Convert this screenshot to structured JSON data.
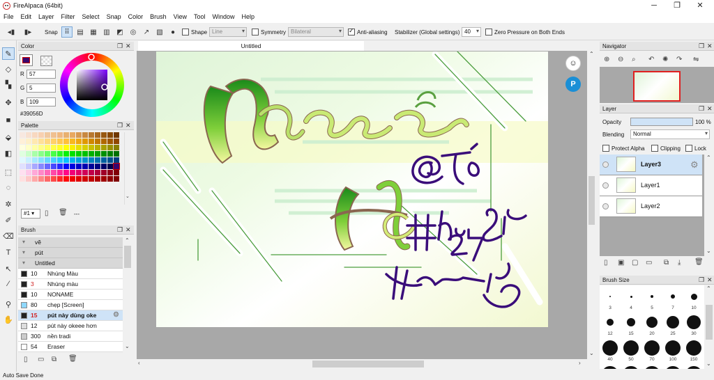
{
  "window": {
    "title": "FireAlpaca (64bit)",
    "minimize": "─",
    "maximize": "❐",
    "close": "✕"
  },
  "menu": [
    "File",
    "Edit",
    "Layer",
    "Filter",
    "Select",
    "Snap",
    "Color",
    "Brush",
    "View",
    "Tool",
    "Window",
    "Help"
  ],
  "toolbar": {
    "snap_label": "Snap",
    "shape_label": "Shape",
    "shape_value": "Line",
    "symmetry_label": "Symmetry",
    "symmetry_value": "Bilateral",
    "antialias_label": "Anti-aliasing",
    "stabilizer_label": "Stabilizer (Global settings)",
    "stabilizer_value": "40",
    "zero_pressure_label": "Zero Pressure on Both Ends"
  },
  "color_panel": {
    "title": "Color",
    "r_label": "R",
    "r": "57",
    "g_label": "G",
    "g": "5",
    "b_label": "B",
    "b": "109",
    "hex": "#39056D",
    "current_color": "#39056d"
  },
  "palette_panel": {
    "title": "Palette",
    "index": "#1",
    "separator": "---",
    "colors": [
      [
        "#f8e8e0",
        "#f8e0d0",
        "#f8d8c0",
        "#f8d0b0",
        "#f0c8a0",
        "#f0c090",
        "#f0b880",
        "#e8b070",
        "#e8a860",
        "#d89850",
        "#c88840",
        "#b87830",
        "#a86820",
        "#985810",
        "#884800",
        "#703800"
      ],
      [
        "#fff0d8",
        "#fff0c8",
        "#ffe8b0",
        "#ffe098",
        "#ffd880",
        "#ffd068",
        "#ffc850",
        "#ffc038",
        "#f8b820",
        "#f0a810",
        "#e09800",
        "#d08800",
        "#c07800",
        "#b06800",
        "#a05800",
        "#904800"
      ],
      [
        "#ffffe0",
        "#ffffc8",
        "#ffffa8",
        "#ffff88",
        "#ffff68",
        "#ffff48",
        "#ffff28",
        "#ffff08",
        "#f8f000",
        "#e8e000",
        "#d8d000",
        "#c8c000",
        "#b8b000",
        "#a8a000",
        "#989000",
        "#888000"
      ],
      [
        "#e0ffe0",
        "#c8ffc8",
        "#a8ffa8",
        "#88ff88",
        "#68ff68",
        "#48ff48",
        "#28f828",
        "#08f008",
        "#00e000",
        "#00d000",
        "#00c000",
        "#00b000",
        "#00a000",
        "#009000",
        "#008000",
        "#007000"
      ],
      [
        "#e0f8ff",
        "#c8f0ff",
        "#a8e8ff",
        "#88e0ff",
        "#68d8ff",
        "#48d0ff",
        "#28c8ff",
        "#08c0ff",
        "#00b0f0",
        "#00a0e0",
        "#0090d0",
        "#0080c0",
        "#0070b0",
        "#0060a0",
        "#005090",
        "#004080"
      ],
      [
        "#e0e0ff",
        "#c8c8ff",
        "#a8a8ff",
        "#8888ff",
        "#6868ff",
        "#4848ff",
        "#2828ff",
        "#0808f8",
        "#0000e0",
        "#0000c8",
        "#0000b0",
        "#000098",
        "#000080",
        "#000068",
        "#000050",
        "#39056d"
      ],
      [
        "#ffe0f0",
        "#ffc8e8",
        "#ffa8d8",
        "#ff88c8",
        "#ff68b8",
        "#ff48a8",
        "#ff2898",
        "#ff0888",
        "#f00078",
        "#e00068",
        "#d00058",
        "#c00048",
        "#b00038",
        "#a00028",
        "#900018",
        "#800008"
      ],
      [
        "#ffe0e0",
        "#ffc8c8",
        "#ffa8a8",
        "#ff8888",
        "#ff6868",
        "#ff4848",
        "#ff2828",
        "#ff0808",
        "#f00000",
        "#e00000",
        "#d00000",
        "#c00000",
        "#b00000",
        "#a00000",
        "#900000",
        "#800000"
      ]
    ]
  },
  "brush_panel": {
    "title": "Brush",
    "groups": [
      "vẽ",
      "pút",
      "Untitled"
    ],
    "items": [
      {
        "size": "10",
        "name": "Nhúng Màu",
        "color": "#222222"
      },
      {
        "size": "3",
        "name": "Nhúng màu",
        "color": "#222222"
      },
      {
        "size": "10",
        "name": "NONAME",
        "color": "#222222"
      },
      {
        "size": "80",
        "name": "chẹp [Screen]",
        "color": "#8fd8ff"
      },
      {
        "size": "15",
        "name": "pút này dùng oke",
        "color": "#222222"
      },
      {
        "size": "12",
        "name": "pút này okeee hơn",
        "color": "#dddddd"
      },
      {
        "size": "300",
        "name": "nền tradi",
        "color": "#cccccc"
      },
      {
        "size": "54",
        "name": "Eraser",
        "color": "#ffffff"
      }
    ]
  },
  "document": {
    "tab_title": "Untitled"
  },
  "artwork": {
    "name_text": "Nguyễn",
    "second_text": "Hà",
    "tag1": "@Tô",
    "tag2": "#Hỏi đáp",
    "tag3": "24/7",
    "tag4": "#Thanh Tuyết"
  },
  "navigator": {
    "title": "Navigator"
  },
  "layer_panel": {
    "title": "Layer",
    "opacity_label": "Opacity",
    "opacity_value": "100 %",
    "opacity": 1.0,
    "blending_label": "Blending",
    "blending_value": "Normal",
    "protect_alpha": "Protect Alpha",
    "clipping": "Clipping",
    "lock": "Lock",
    "layers": [
      "Layer3",
      "Layer1",
      "Layer2"
    ]
  },
  "brush_size_panel": {
    "title": "Brush Size",
    "sizes": [
      "3",
      "4",
      "5",
      "7",
      "10",
      "12",
      "15",
      "20",
      "25",
      "30",
      "40",
      "50",
      "70",
      "100",
      "150"
    ]
  },
  "status": {
    "text": "Auto Save Done"
  }
}
